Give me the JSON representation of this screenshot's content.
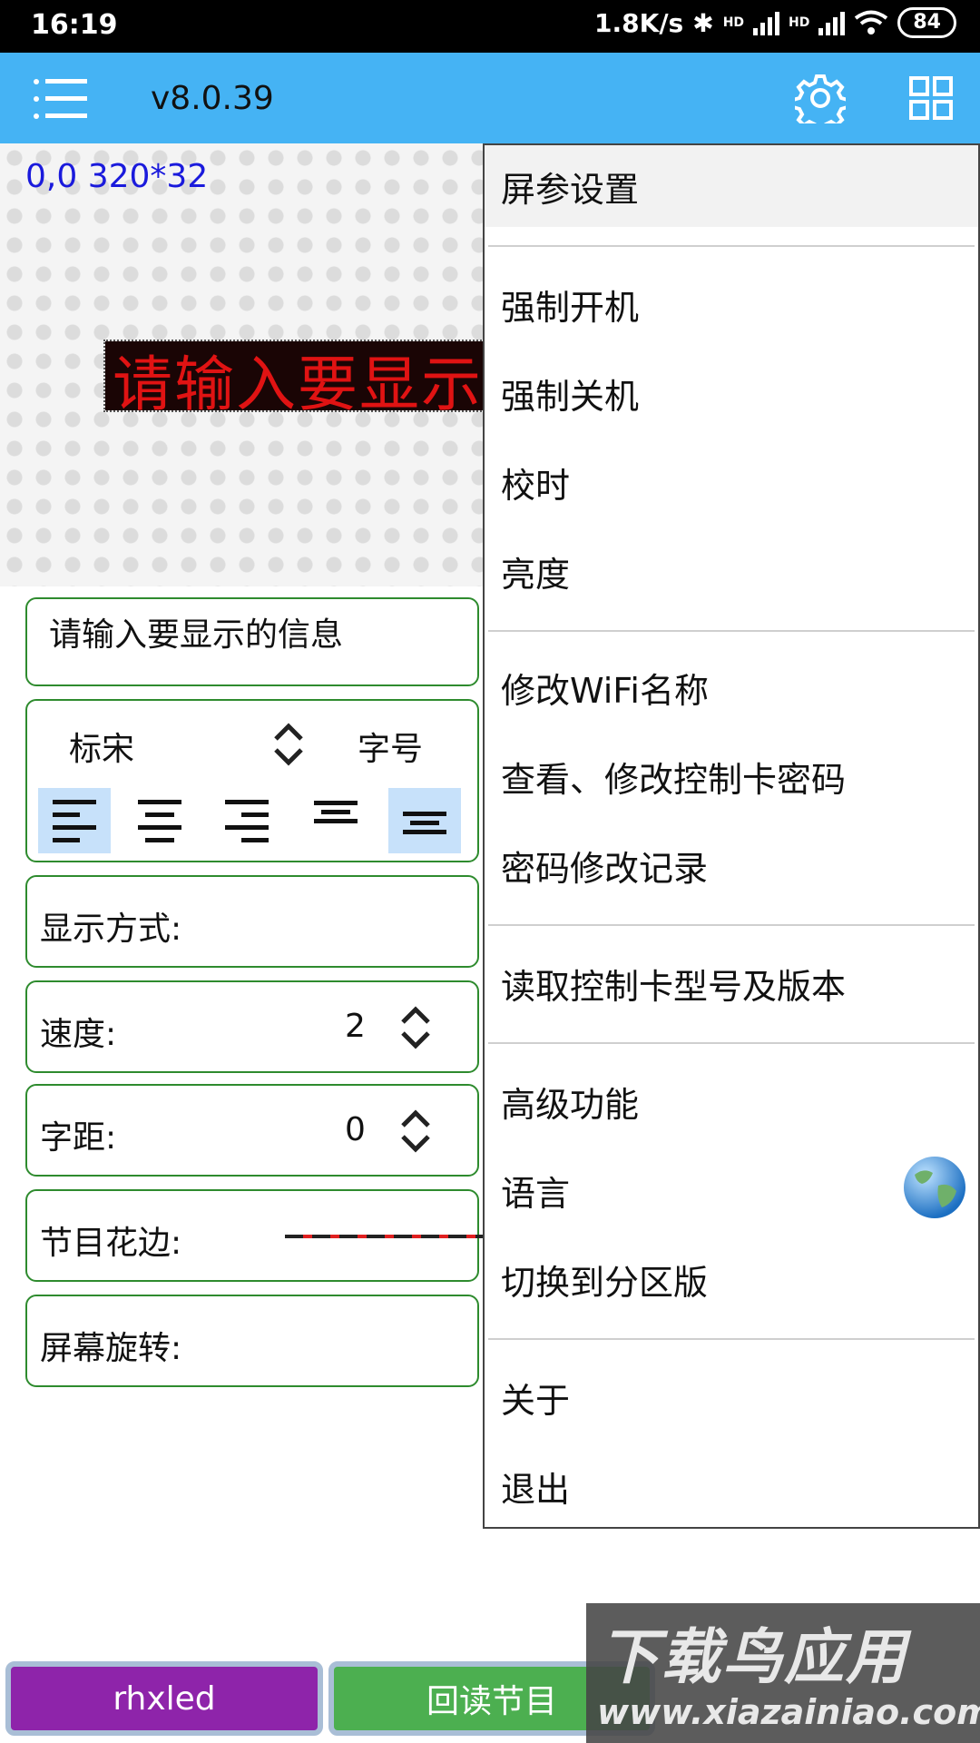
{
  "status_bar": {
    "time": "16:19",
    "net_speed": "1.8K/s",
    "network1": "HD",
    "network2": "HD",
    "battery": "84"
  },
  "app_bar": {
    "version": "v8.0.39",
    "bg_color": "#45b3f4"
  },
  "preview": {
    "coords": "0,0 320*32",
    "led_text": "请输入要显示的信息",
    "led_color": "#e01313"
  },
  "form": {
    "text_input_value": "请输入要显示的信息",
    "font_name": "标宋",
    "font_size_label": "字号",
    "display_mode_label": "显示方式:",
    "speed_label": "速度:",
    "speed_value": "2",
    "spacing_label": "字距:",
    "spacing_value": "0",
    "border_label": "节目花边:",
    "rotation_label": "屏幕旋转:"
  },
  "menu": {
    "items": [
      "屏参设置",
      "强制开机",
      "强制关机",
      "校时",
      "亮度",
      "修改WiFi名称",
      "查看、修改控制卡密码",
      "密码修改记录",
      "读取控制卡型号及版本",
      "高级功能",
      "语言",
      "切换到分区版",
      "关于",
      "退出"
    ]
  },
  "bottom": {
    "btn1": "rhxled",
    "btn1_color": "#8e24aa",
    "btn2": "回读节目",
    "btn2_color": "#4caf50"
  },
  "watermark": {
    "title": "下载鸟应用",
    "url": "www.xiazainiao.com"
  }
}
